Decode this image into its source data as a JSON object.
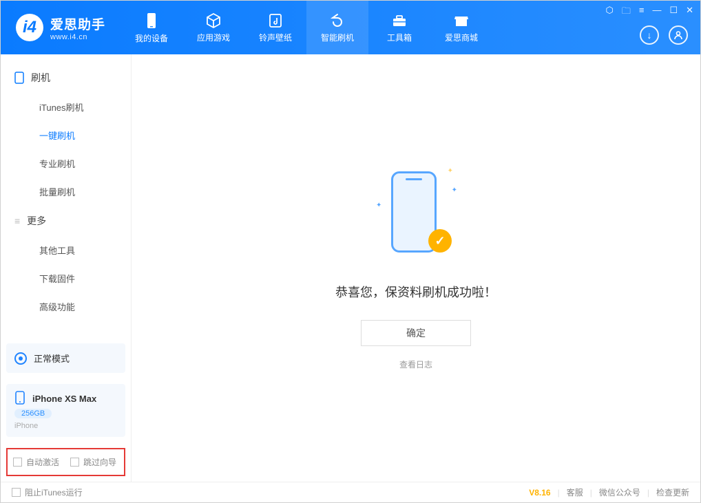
{
  "brand": {
    "name": "爱思助手",
    "url": "www.i4.cn"
  },
  "tabs": [
    {
      "label": "我的设备",
      "icon": "device"
    },
    {
      "label": "应用游戏",
      "icon": "cube"
    },
    {
      "label": "铃声壁纸",
      "icon": "music"
    },
    {
      "label": "智能刷机",
      "icon": "refresh",
      "active": true
    },
    {
      "label": "工具箱",
      "icon": "toolbox"
    },
    {
      "label": "爱思商城",
      "icon": "store"
    }
  ],
  "sidebar": {
    "groups": [
      {
        "title": "刷机",
        "icon": "phone",
        "items": [
          {
            "label": "iTunes刷机"
          },
          {
            "label": "一键刷机",
            "active": true
          },
          {
            "label": "专业刷机"
          },
          {
            "label": "批量刷机"
          }
        ]
      },
      {
        "title": "更多",
        "icon": "menu",
        "items": [
          {
            "label": "其他工具"
          },
          {
            "label": "下载固件"
          },
          {
            "label": "高级功能"
          }
        ]
      }
    ],
    "mode": {
      "label": "正常模式"
    },
    "device": {
      "name": "iPhone XS Max",
      "capacity": "256GB",
      "type": "iPhone"
    },
    "auto": {
      "activate": "自动激活",
      "skip": "跳过向导"
    }
  },
  "main": {
    "success": "恭喜您，保资料刷机成功啦！",
    "ok": "确定",
    "log": "查看日志"
  },
  "footer": {
    "block_itunes": "阻止iTunes运行",
    "version": "V8.16",
    "support": "客服",
    "wechat": "微信公众号",
    "update": "检查更新"
  }
}
